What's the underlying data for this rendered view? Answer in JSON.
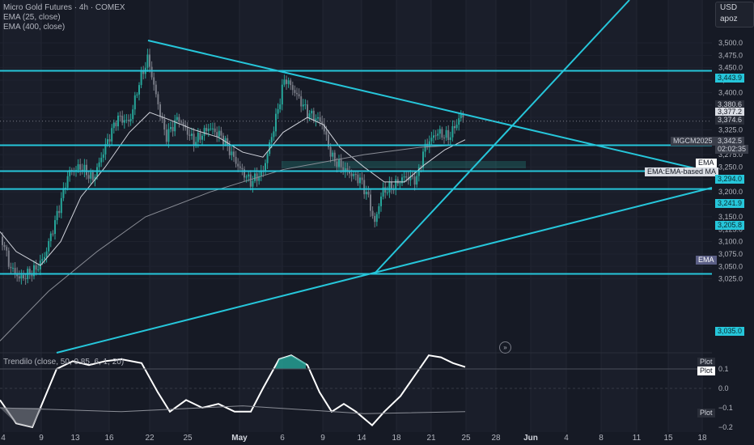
{
  "header": {
    "symbol_title": "Micro Gold Futures · 4h · COMEX",
    "indicator_1": "EMA (25, close)",
    "indicator_2": "EMA (400, close)"
  },
  "oscillator": {
    "legend": "Trendilo (close, 50, 0.85, 6, 1, 20)",
    "levels": [
      "0.1",
      "0.0",
      "−0.1",
      "−0.2"
    ]
  },
  "currency": {
    "label": "USD",
    "sub": "apoz"
  },
  "price_axis": {
    "ticks": [
      "3,500.0",
      "3,475.0",
      "3,450.0",
      "3,425.0",
      "3,400.0",
      "3,375.0",
      "3,350.0",
      "3,325.0",
      "3,300.0",
      "3,275.0",
      "3,250.0",
      "3,225.0",
      "3,200.0",
      "3,175.0",
      "3,150.0",
      "3,125.0",
      "3,100.0",
      "3,075.0",
      "3,050.0",
      "3,025.0"
    ]
  },
  "price_labels": {
    "level_3443": "3,443.9",
    "val_3380": "3,380.6",
    "val_3377": "3,377.2",
    "val_3374": "3,374.6",
    "symbol": "MGCM2025",
    "last_price": "3,342.5",
    "countdown": "02:02:35",
    "ema_tag": "EMA",
    "ema_based_tag": "EMA:EMA-based MA",
    "level_3294": "3,294.0",
    "level_3241": "3,241.9",
    "level_3205": "3,205.8",
    "ema_tag_2": "EMA",
    "level_3035": "3,035.0"
  },
  "osc_labels": {
    "plot_1": "Plot",
    "plot_2": "Plot",
    "plot_3": "Plot"
  },
  "time_axis": [
    {
      "label": "4",
      "bold": false
    },
    {
      "label": "9",
      "bold": false
    },
    {
      "label": "13",
      "bold": false
    },
    {
      "label": "16",
      "bold": false
    },
    {
      "label": "22",
      "bold": false
    },
    {
      "label": "25",
      "bold": false
    },
    {
      "label": "May",
      "bold": true
    },
    {
      "label": "6",
      "bold": false
    },
    {
      "label": "9",
      "bold": false
    },
    {
      "label": "14",
      "bold": false
    },
    {
      "label": "18",
      "bold": false
    },
    {
      "label": "21",
      "bold": false
    },
    {
      "label": "25",
      "bold": false
    },
    {
      "label": "28",
      "bold": false
    },
    {
      "label": "Jun",
      "bold": true
    },
    {
      "label": "4",
      "bold": false
    },
    {
      "label": "8",
      "bold": false
    },
    {
      "label": "11",
      "bold": false
    },
    {
      "label": "15",
      "bold": false
    },
    {
      "label": "18",
      "bold": false
    }
  ],
  "colors": {
    "background": "#161a25",
    "level": "#26c6da",
    "up": "#26a69a",
    "down": "#787b86"
  },
  "goto_icon": "double-chevron-right-icon"
}
